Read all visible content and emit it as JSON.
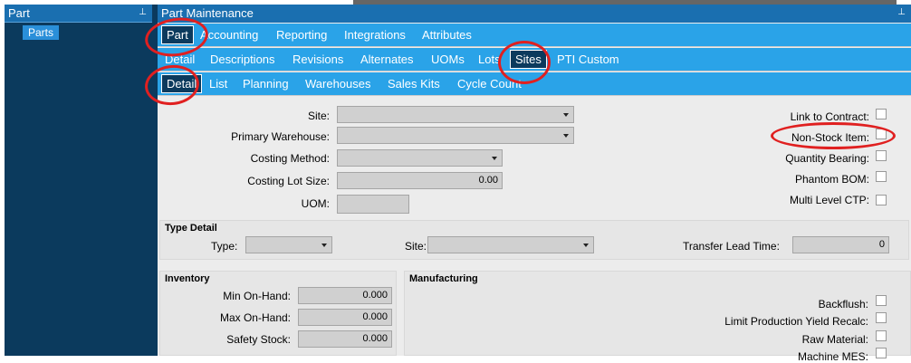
{
  "left_panel": {
    "title": "Part",
    "tree_item": "Parts"
  },
  "main": {
    "title": "Part Maintenance"
  },
  "tabs_row1": [
    "Part",
    "Accounting",
    "Reporting",
    "Integrations",
    "Attributes"
  ],
  "tabs_row2": [
    "Detail",
    "Descriptions",
    "Revisions",
    "Alternates",
    "UOMs",
    "Lots",
    "Sites",
    "PTI Custom"
  ],
  "tabs_row3": [
    "Detail",
    "List",
    "Planning",
    "Warehouses",
    "Sales Kits",
    "Cycle Count"
  ],
  "form": {
    "site_label": "Site:",
    "primary_wh_label": "Primary Warehouse:",
    "costing_method_label": "Costing Method:",
    "costing_lot_label": "Costing Lot Size:",
    "costing_lot_value": "0.00",
    "uom_label": "UOM:"
  },
  "checks": {
    "link_to_contract": "Link to Contract:",
    "non_stock": "Non-Stock Item:",
    "qty_bearing": "Quantity Bearing:",
    "phantom_bom": "Phantom BOM:",
    "multi_ctp": "Multi Level CTP:"
  },
  "type_detail": {
    "title": "Type Detail",
    "type_label": "Type:",
    "site_label": "Site:",
    "transfer_label": "Transfer Lead Time:",
    "transfer_value": "0"
  },
  "inventory": {
    "title": "Inventory",
    "min_label": "Min On-Hand:",
    "min_value": "0.000",
    "max_label": "Max On-Hand:",
    "max_value": "0.000",
    "safety_label": "Safety Stock:",
    "safety_value": "0.000"
  },
  "manufacturing": {
    "title": "Manufacturing",
    "backflush": "Backflush:",
    "limit_yield": "Limit Production Yield Recalc:",
    "raw_material": "Raw Material:",
    "machine_mes": "Machine MES:"
  },
  "colors": {
    "header": "#1a6fb0",
    "tab_bar": "#2aa3e8",
    "dark_panel": "#0b3a5d",
    "annotation": "#e02020"
  }
}
